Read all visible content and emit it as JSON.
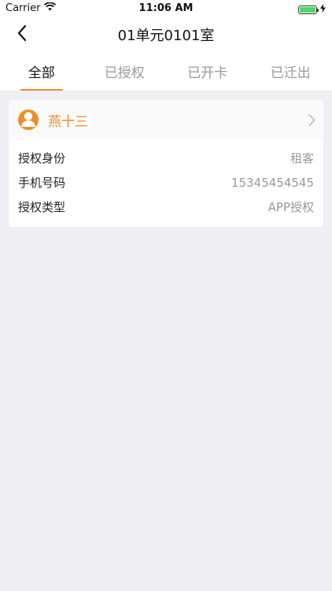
{
  "status_bar": {
    "carrier": "Carrier",
    "time": "11:06 AM"
  },
  "nav": {
    "title": "01单元0101室"
  },
  "tabs": [
    {
      "label": "全部",
      "active": true
    },
    {
      "label": "已授权",
      "active": false
    },
    {
      "label": "已开卡",
      "active": false
    },
    {
      "label": "已迁出",
      "active": false
    }
  ],
  "card": {
    "name": "燕十三",
    "rows": [
      {
        "label": "授权身份",
        "value": "租客"
      },
      {
        "label": "手机号码",
        "value": "15345454545"
      },
      {
        "label": "授权类型",
        "value": "APP授权"
      }
    ]
  },
  "colors": {
    "accent": "#f08c2a",
    "background": "#efeff4"
  }
}
